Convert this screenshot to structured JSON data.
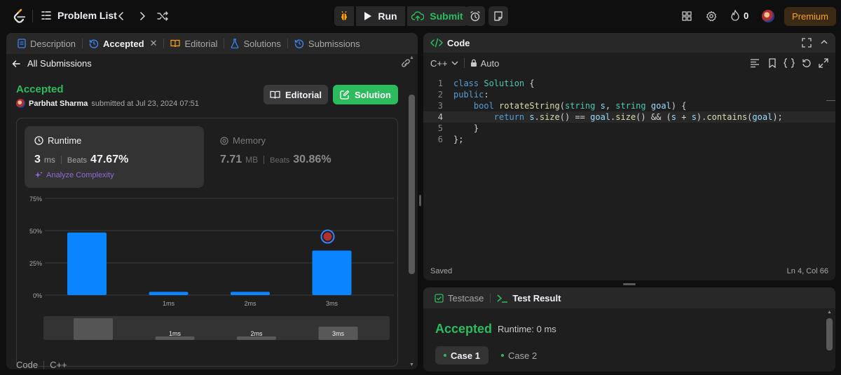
{
  "topbar": {
    "problem_list": "Problem List",
    "run": "Run",
    "submit": "Submit",
    "streak_count": "0",
    "premium": "Premium"
  },
  "left": {
    "tabs": [
      {
        "label": "Description",
        "icon": "description-icon"
      },
      {
        "label": "Accepted",
        "icon": "history-icon"
      },
      {
        "label": "Editorial",
        "icon": "book-icon"
      },
      {
        "label": "Solutions",
        "icon": "flask-icon"
      },
      {
        "label": "Submissions",
        "icon": "history-icon"
      }
    ],
    "all_submissions": "All Submissions",
    "status": "Accepted",
    "user": "Parbhat Sharma",
    "submitted_at": "submitted at Jul 23, 2024 07:51",
    "editorial_btn": "Editorial",
    "solution_btn": "Solution",
    "runtime": {
      "label": "Runtime",
      "value": "3",
      "unit": "ms",
      "beats_label": "Beats",
      "beats": "47.67%",
      "analyze": "Analyze Complexity"
    },
    "memory": {
      "label": "Memory",
      "value": "7.71",
      "unit": "MB",
      "beats_label": "Beats",
      "beats": "30.86%"
    },
    "footer": {
      "code": "Code",
      "lang": "C++"
    }
  },
  "chart_data": {
    "type": "bar",
    "categories": [
      "",
      "1ms",
      "2ms",
      "3ms"
    ],
    "values": [
      48.5,
      2.5,
      2.5,
      34.5
    ],
    "highlight_index": 3,
    "ylim": [
      0,
      75
    ],
    "yticks": [
      "0%",
      "25%",
      "50%",
      "75%"
    ],
    "ytick_values": [
      0,
      25,
      50,
      75
    ],
    "bar_color": "#0a84ff",
    "mini_values": [
      31,
      5,
      5,
      19
    ],
    "mini_labels": [
      "",
      "1ms",
      "2ms",
      "3ms"
    ]
  },
  "editor": {
    "title": "Code",
    "language": "C++",
    "mode": "Auto",
    "lines": [
      "class Solution {",
      "public:",
      "    bool rotateString(string s, string goal) {",
      "        return s.size() == goal.size() && (s + s).contains(goal);",
      "    }",
      "};"
    ],
    "saved": "Saved",
    "cursor": "Ln 4, Col 66"
  },
  "test": {
    "testcase_tab": "Testcase",
    "result_tab": "Test Result",
    "status": "Accepted",
    "runtime": "Runtime: 0 ms",
    "cases": [
      "Case 1",
      "Case 2"
    ]
  },
  "colors": {
    "accent_green": "#2cbb5d",
    "premium": "#ffa116",
    "bar": "#0a84ff"
  }
}
